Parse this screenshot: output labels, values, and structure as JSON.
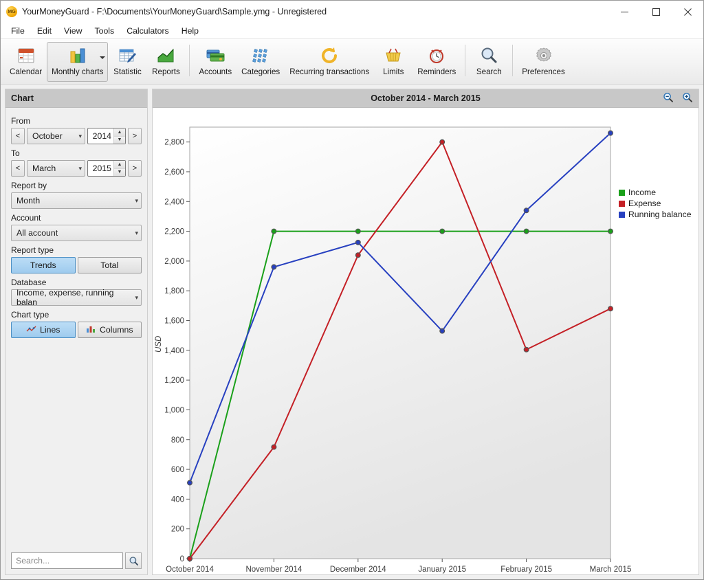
{
  "window": {
    "title": "YourMoneyGuard - F:\\Documents\\YourMoneyGuard\\Sample.ymg - Unregistered",
    "app_icon_text": "MG",
    "minimize": "—",
    "maximize": "□",
    "close": "✕"
  },
  "menubar": {
    "items": [
      {
        "label": "File"
      },
      {
        "label": "Edit"
      },
      {
        "label": "View"
      },
      {
        "label": "Tools"
      },
      {
        "label": "Calculators"
      },
      {
        "label": "Help"
      }
    ]
  },
  "toolbar": {
    "buttons": [
      {
        "label": "Calendar",
        "icon": "calendar-icon",
        "active": false,
        "dropdown": false
      },
      {
        "label": "Monthly charts",
        "icon": "bar-chart-icon",
        "active": true,
        "dropdown": true
      },
      {
        "label": "Statistic",
        "icon": "statistic-icon",
        "active": false,
        "dropdown": false
      },
      {
        "label": "Reports",
        "icon": "reports-icon",
        "active": false,
        "dropdown": false
      },
      {
        "label": "Accounts",
        "icon": "credit-card-icon",
        "active": false,
        "dropdown": false
      },
      {
        "label": "Categories",
        "icon": "categories-icon",
        "active": false,
        "dropdown": false
      },
      {
        "label": "Recurring transactions",
        "icon": "recurring-icon",
        "active": false,
        "dropdown": false
      },
      {
        "label": "Limits",
        "icon": "basket-icon",
        "active": false,
        "dropdown": false
      },
      {
        "label": "Reminders",
        "icon": "alarm-clock-icon",
        "active": false,
        "dropdown": false
      },
      {
        "label": "Search",
        "icon": "magnifier-icon",
        "active": false,
        "dropdown": false
      },
      {
        "label": "Preferences",
        "icon": "gear-icon",
        "active": false,
        "dropdown": false
      }
    ]
  },
  "sidebar": {
    "header": "Chart",
    "from": {
      "label": "From",
      "prev": "<",
      "next": ">",
      "month": "October",
      "year": "2014"
    },
    "to": {
      "label": "To",
      "prev": "<",
      "next": ">",
      "month": "March",
      "year": "2015"
    },
    "report_by": {
      "label": "Report by",
      "value": "Month"
    },
    "account": {
      "label": "Account",
      "value": "All account"
    },
    "report_type": {
      "label": "Report type",
      "trends": "Trends",
      "total": "Total",
      "selected": "Trends"
    },
    "database": {
      "label": "Database",
      "value": "Income, expense, running balan"
    },
    "chart_type": {
      "label": "Chart type",
      "lines": "Lines",
      "columns": "Columns",
      "selected": "Lines"
    },
    "search": {
      "placeholder": "Search...",
      "value": ""
    }
  },
  "chart_panel": {
    "title": "October 2014 - March 2015",
    "zoom_out": "zoom-out-icon",
    "zoom_in": "zoom-in-icon"
  },
  "chart_data": {
    "type": "line",
    "title": "October 2014 - March 2015",
    "xlabel": "",
    "ylabel": "USD",
    "categories": [
      "October 2014",
      "November 2014",
      "December 2014",
      "January 2015",
      "February 2015",
      "March 2015"
    ],
    "ylim": [
      0,
      2900
    ],
    "yticks": [
      0,
      200,
      400,
      600,
      800,
      1000,
      1200,
      1400,
      1600,
      1800,
      2000,
      2200,
      2400,
      2600,
      2800
    ],
    "ytick_labels": [
      "0",
      "200",
      "400",
      "600",
      "800",
      "1,000",
      "1,200",
      "1,400",
      "1,600",
      "1,800",
      "2,000",
      "2,200",
      "2,400",
      "2,600",
      "2,800"
    ],
    "grid": false,
    "legend_position": "right",
    "series": [
      {
        "name": "Income",
        "color": "#1aa01a",
        "values": [
          0,
          2200,
          2200,
          2200,
          2200,
          2200
        ]
      },
      {
        "name": "Expense",
        "color": "#c42026",
        "values": [
          0,
          750,
          2040,
          2800,
          1405,
          1680
        ]
      },
      {
        "name": "Running balance",
        "color": "#2740c0",
        "values": [
          510,
          1960,
          2125,
          1530,
          2340,
          2860
        ]
      }
    ]
  }
}
